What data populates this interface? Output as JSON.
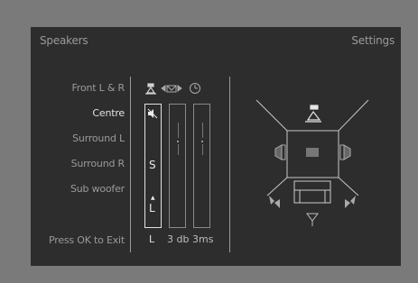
{
  "header": {
    "title": "Speakers",
    "settings_label": "Settings"
  },
  "speakers": {
    "rows": [
      {
        "label": "Front L & R",
        "active": false
      },
      {
        "label": "Centre",
        "active": true
      },
      {
        "label": "Surround L",
        "active": false
      },
      {
        "label": "Surround R",
        "active": false
      },
      {
        "label": "Sub woofer",
        "active": false
      }
    ]
  },
  "footer": {
    "exit_hint": "Press OK to Exit"
  },
  "columns": {
    "size": {
      "icon": "speaker-icon",
      "middle_value": "S",
      "bottom_value": "L",
      "footer_value": "L"
    },
    "level": {
      "icon": "triangle-arrows-icon",
      "footer_value": "3 db"
    },
    "delay": {
      "icon": "clock-icon",
      "footer_value": "3ms"
    }
  },
  "colors": {
    "background": "#7a7a7a",
    "panel": "#2d2d2d",
    "text": "#9a9a9a",
    "active": "#e2e2e2"
  }
}
